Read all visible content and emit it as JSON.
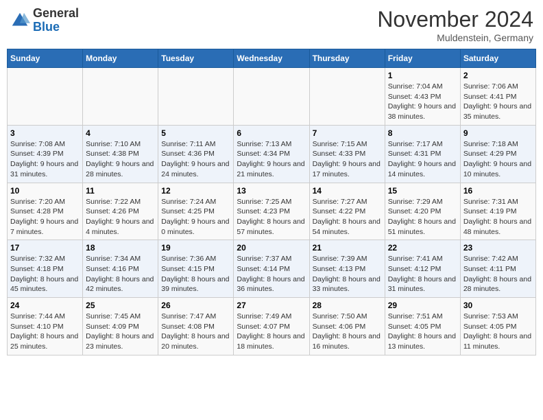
{
  "header": {
    "logo_general": "General",
    "logo_blue": "Blue",
    "month_title": "November 2024",
    "location": "Muldenstein, Germany"
  },
  "days_of_week": [
    "Sunday",
    "Monday",
    "Tuesday",
    "Wednesday",
    "Thursday",
    "Friday",
    "Saturday"
  ],
  "weeks": [
    [
      {
        "day": "",
        "info": ""
      },
      {
        "day": "",
        "info": ""
      },
      {
        "day": "",
        "info": ""
      },
      {
        "day": "",
        "info": ""
      },
      {
        "day": "",
        "info": ""
      },
      {
        "day": "1",
        "info": "Sunrise: 7:04 AM\nSunset: 4:43 PM\nDaylight: 9 hours and 38 minutes."
      },
      {
        "day": "2",
        "info": "Sunrise: 7:06 AM\nSunset: 4:41 PM\nDaylight: 9 hours and 35 minutes."
      }
    ],
    [
      {
        "day": "3",
        "info": "Sunrise: 7:08 AM\nSunset: 4:39 PM\nDaylight: 9 hours and 31 minutes."
      },
      {
        "day": "4",
        "info": "Sunrise: 7:10 AM\nSunset: 4:38 PM\nDaylight: 9 hours and 28 minutes."
      },
      {
        "day": "5",
        "info": "Sunrise: 7:11 AM\nSunset: 4:36 PM\nDaylight: 9 hours and 24 minutes."
      },
      {
        "day": "6",
        "info": "Sunrise: 7:13 AM\nSunset: 4:34 PM\nDaylight: 9 hours and 21 minutes."
      },
      {
        "day": "7",
        "info": "Sunrise: 7:15 AM\nSunset: 4:33 PM\nDaylight: 9 hours and 17 minutes."
      },
      {
        "day": "8",
        "info": "Sunrise: 7:17 AM\nSunset: 4:31 PM\nDaylight: 9 hours and 14 minutes."
      },
      {
        "day": "9",
        "info": "Sunrise: 7:18 AM\nSunset: 4:29 PM\nDaylight: 9 hours and 10 minutes."
      }
    ],
    [
      {
        "day": "10",
        "info": "Sunrise: 7:20 AM\nSunset: 4:28 PM\nDaylight: 9 hours and 7 minutes."
      },
      {
        "day": "11",
        "info": "Sunrise: 7:22 AM\nSunset: 4:26 PM\nDaylight: 9 hours and 4 minutes."
      },
      {
        "day": "12",
        "info": "Sunrise: 7:24 AM\nSunset: 4:25 PM\nDaylight: 9 hours and 0 minutes."
      },
      {
        "day": "13",
        "info": "Sunrise: 7:25 AM\nSunset: 4:23 PM\nDaylight: 8 hours and 57 minutes."
      },
      {
        "day": "14",
        "info": "Sunrise: 7:27 AM\nSunset: 4:22 PM\nDaylight: 8 hours and 54 minutes."
      },
      {
        "day": "15",
        "info": "Sunrise: 7:29 AM\nSunset: 4:20 PM\nDaylight: 8 hours and 51 minutes."
      },
      {
        "day": "16",
        "info": "Sunrise: 7:31 AM\nSunset: 4:19 PM\nDaylight: 8 hours and 48 minutes."
      }
    ],
    [
      {
        "day": "17",
        "info": "Sunrise: 7:32 AM\nSunset: 4:18 PM\nDaylight: 8 hours and 45 minutes."
      },
      {
        "day": "18",
        "info": "Sunrise: 7:34 AM\nSunset: 4:16 PM\nDaylight: 8 hours and 42 minutes."
      },
      {
        "day": "19",
        "info": "Sunrise: 7:36 AM\nSunset: 4:15 PM\nDaylight: 8 hours and 39 minutes."
      },
      {
        "day": "20",
        "info": "Sunrise: 7:37 AM\nSunset: 4:14 PM\nDaylight: 8 hours and 36 minutes."
      },
      {
        "day": "21",
        "info": "Sunrise: 7:39 AM\nSunset: 4:13 PM\nDaylight: 8 hours and 33 minutes."
      },
      {
        "day": "22",
        "info": "Sunrise: 7:41 AM\nSunset: 4:12 PM\nDaylight: 8 hours and 31 minutes."
      },
      {
        "day": "23",
        "info": "Sunrise: 7:42 AM\nSunset: 4:11 PM\nDaylight: 8 hours and 28 minutes."
      }
    ],
    [
      {
        "day": "24",
        "info": "Sunrise: 7:44 AM\nSunset: 4:10 PM\nDaylight: 8 hours and 25 minutes."
      },
      {
        "day": "25",
        "info": "Sunrise: 7:45 AM\nSunset: 4:09 PM\nDaylight: 8 hours and 23 minutes."
      },
      {
        "day": "26",
        "info": "Sunrise: 7:47 AM\nSunset: 4:08 PM\nDaylight: 8 hours and 20 minutes."
      },
      {
        "day": "27",
        "info": "Sunrise: 7:49 AM\nSunset: 4:07 PM\nDaylight: 8 hours and 18 minutes."
      },
      {
        "day": "28",
        "info": "Sunrise: 7:50 AM\nSunset: 4:06 PM\nDaylight: 8 hours and 16 minutes."
      },
      {
        "day": "29",
        "info": "Sunrise: 7:51 AM\nSunset: 4:05 PM\nDaylight: 8 hours and 13 minutes."
      },
      {
        "day": "30",
        "info": "Sunrise: 7:53 AM\nSunset: 4:05 PM\nDaylight: 8 hours and 11 minutes."
      }
    ]
  ]
}
